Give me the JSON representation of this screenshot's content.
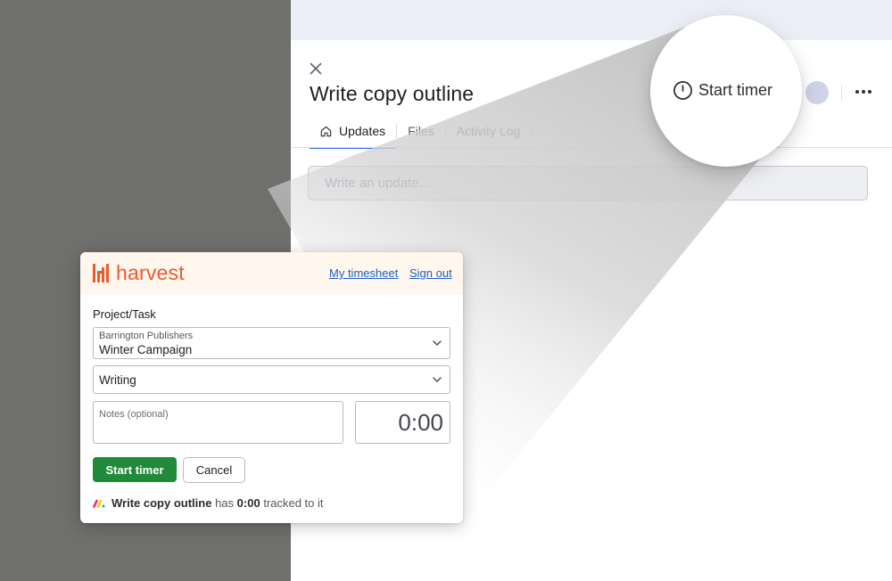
{
  "item": {
    "title": "Write copy outline"
  },
  "tabs": [
    {
      "label": "Updates",
      "active": true
    },
    {
      "label": "Files",
      "active": false
    },
    {
      "label": "Activity Log",
      "active": false
    }
  ],
  "update_input": {
    "placeholder": "Write an update..."
  },
  "magnifier": {
    "button_label": "Start timer"
  },
  "harvest": {
    "logo_text": "harvest",
    "links": {
      "timesheet": "My timesheet",
      "sign_out": "Sign out"
    },
    "project_task_label": "Project/Task",
    "project": {
      "client": "Barrington Publishers",
      "name": "Winter Campaign"
    },
    "task": "Writing",
    "notes_placeholder": "Notes (optional)",
    "duration": "0:00",
    "start_button": "Start timer",
    "cancel_button": "Cancel",
    "tracked": {
      "item": "Write copy outline",
      "middle": "has",
      "time": "0:00",
      "suffix": "tracked to it"
    }
  },
  "colors": {
    "harvest_orange": "#ec5a2c",
    "start_green": "#1f8a3a",
    "link_blue": "#1d5fbf",
    "tab_underline": "#2f6fd6"
  }
}
